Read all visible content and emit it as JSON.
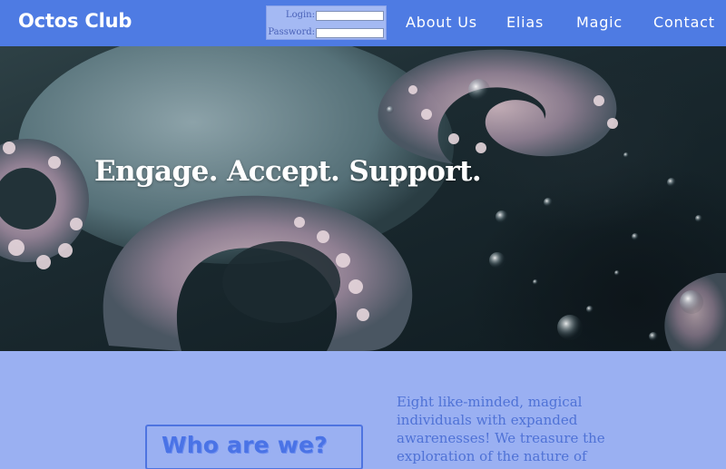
{
  "header": {
    "logo": "Octos Club",
    "login": {
      "login_label": "Login:",
      "login_value": "",
      "password_label": "Password:",
      "password_value": ""
    },
    "nav": [
      "About Us",
      "Elias",
      "Magic",
      "Contact"
    ]
  },
  "hero": {
    "tagline": "Engage. Accept. Support."
  },
  "about": {
    "heading": "Who are we?",
    "text": "Eight like-minded, magical individuals with expanded awarenesses! We treasure the exploration of the nature of"
  },
  "colors": {
    "header_bg": "#4e7be3",
    "page_bg": "#9ab0f2",
    "accent": "#4a73e6"
  }
}
